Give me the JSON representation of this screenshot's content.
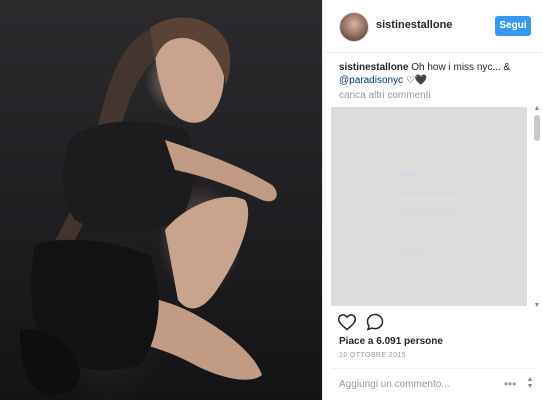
{
  "post": {
    "username": "sistinestallone",
    "follow_label": "Segui",
    "caption": {
      "user": "sistinestallone",
      "text": "Oh how i miss nyc... &",
      "mention": "@paradisonyc",
      "emoji": "♡🖤"
    },
    "load_more_label": "carica altri commenti",
    "likes_label": "Piace a 6.091 persone",
    "date_label": "16 OTTOBRE 2015",
    "comment_placeholder": "Aggiungi un commento...",
    "more_label": "•••"
  },
  "icons": {
    "like": "heart-icon",
    "comment": "comment-icon",
    "more": "more-options-icon"
  },
  "colors": {
    "accent": "#3897f0",
    "mention": "#003569",
    "muted": "#999999",
    "embed_bg": "#dcdcdc"
  }
}
